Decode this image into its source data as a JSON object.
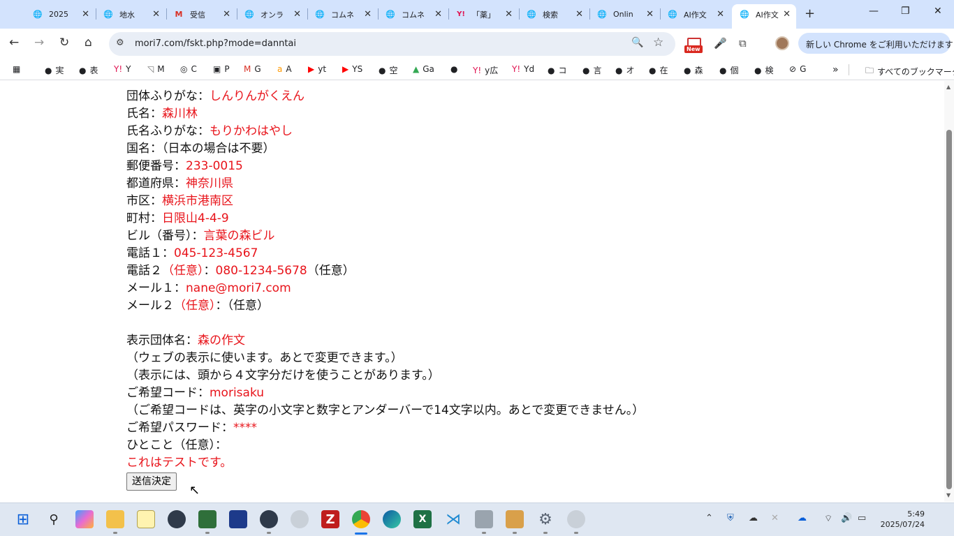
{
  "tabs": [
    {
      "title": "2025",
      "icon": "globe-icon"
    },
    {
      "title": "地水",
      "icon": "globe-icon"
    },
    {
      "title": "受信",
      "icon": "gmail-icon"
    },
    {
      "title": "オンラ",
      "icon": "globe-icon"
    },
    {
      "title": "コムネ",
      "icon": "globe-icon"
    },
    {
      "title": "コムネ",
      "icon": "globe-icon"
    },
    {
      "title": "「薬」",
      "icon": "yahoo-icon"
    },
    {
      "title": "検索",
      "icon": "globe-icon"
    },
    {
      "title": "Onlin",
      "icon": "globe-icon"
    },
    {
      "title": "AI作文",
      "icon": "globe-icon"
    },
    {
      "title": "AI作文",
      "icon": "globe-icon",
      "active": true
    }
  ],
  "toolbar": {
    "url": "mori7.com/fskt.php?mode=danntai",
    "new_badge": "New",
    "chrome_promo": "新しい Chrome をご利用いただけます"
  },
  "bookmarks": {
    "items": [
      "実",
      "表",
      "Y",
      "M",
      "C",
      "P",
      "G",
      "A",
      "yt",
      "YS",
      "空",
      "Ga",
      "",
      "y広",
      "Yd",
      "コ",
      "言",
      "オ",
      "在",
      "森",
      "個",
      "検",
      "G"
    ],
    "all_bookmarks": "すべてのブックマーク"
  },
  "form": {
    "lines": [
      {
        "label": "団体ふりがな：",
        "value": "しんりんがくえん",
        "suffix": ""
      },
      {
        "label": "氏名：",
        "value": "森川林",
        "suffix": ""
      },
      {
        "label": "氏名ふりがな：",
        "value": "もりかわはやし",
        "suffix": ""
      },
      {
        "label": "国名：（日本の場合は不要）",
        "value": "",
        "suffix": ""
      },
      {
        "label": "郵便番号：",
        "value": "233-0015",
        "suffix": ""
      },
      {
        "label": "都道府県：",
        "value": "神奈川県",
        "suffix": ""
      },
      {
        "label": "市区：",
        "value": "横浜市港南区",
        "suffix": ""
      },
      {
        "label": "町村：",
        "value": "日限山4-4-9",
        "suffix": ""
      },
      {
        "label": "ビル（番号）：",
        "value": "言葉の森ビル",
        "suffix": ""
      }
    ],
    "phone1_label": "電話１：",
    "phone1_value": "045-123-4567",
    "phone2_label": "電話２",
    "phone2_optional": "（任意）",
    "phone2_colon": "：",
    "phone2_value": "080-1234-5678",
    "phone2_suffix": "（任意）",
    "mail1_label": "メール１：",
    "mail1_value": "nane@mori7.com",
    "mail2_label": "メール２",
    "mail2_optional": "（任意）",
    "mail2_suffix": "：（任意）",
    "display_name_label": "表示団体名：",
    "display_name_value": "森の作文",
    "display_note1": "（ウェブの表示に使います。あとで変更できます。）",
    "display_note2": "（表示には、頭から４文字分だけを使うことがあります。）",
    "code_label": "ご希望コード：",
    "code_value": "morisaku",
    "code_note": "（ご希望コードは、英字の小文字と数字とアンダーバーで14文字以内。あとで変更できません。）",
    "password_label": "ご希望パスワード：",
    "password_value": "****",
    "comment_label": "ひとこと（任意）：",
    "comment_value": "これはテストです。",
    "submit_label": "送信決定"
  },
  "taskbar": {
    "apps": [
      "windows-start-icon",
      "search-icon",
      "copilot-icon",
      "file-explorer-icon",
      "app-icon",
      "camera-icon",
      "app-icon",
      "app-icon",
      "camera-icon",
      "webcam-icon",
      "filezilla-icon",
      "chrome-icon",
      "edge-icon",
      "excel-icon",
      "vscode-icon",
      "app-icon",
      "app-icon",
      "settings-icon",
      "webcam-icon"
    ],
    "time": "5:49",
    "date": "2025/07/24"
  }
}
